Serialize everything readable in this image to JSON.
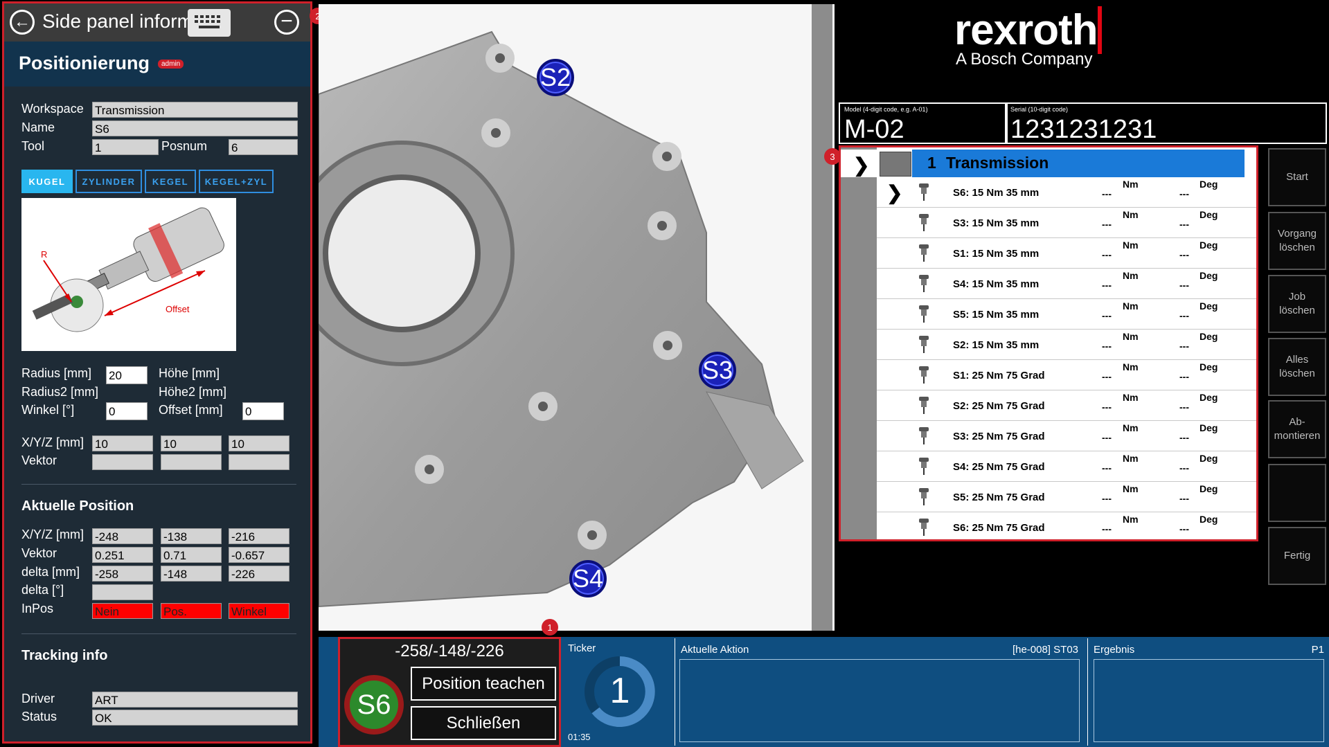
{
  "side_panel": {
    "title": "Side panel inform",
    "back_icon": "arrow-left-icon",
    "keyboard_icon": "keyboard-icon",
    "minimize_icon": "minus-circle-icon",
    "heading": "Positionierung",
    "badge": "admin",
    "workspace": {
      "label": "Workspace",
      "value": "Transmission"
    },
    "name": {
      "label": "Name",
      "value": "S6"
    },
    "tool": {
      "label": "Tool",
      "value": "1"
    },
    "posnum": {
      "label": "Posnum",
      "value": "6"
    },
    "shape_tabs": [
      {
        "label": "KUGEL",
        "active": true
      },
      {
        "label": "ZYLINDER",
        "active": false
      },
      {
        "label": "KEGEL",
        "active": false
      },
      {
        "label": "KEGEL+ZYL",
        "active": false
      }
    ],
    "diagram": {
      "r_label": "R",
      "offset_label": "Offset"
    },
    "radius": {
      "label": "Radius [mm]",
      "value": "20"
    },
    "hoehe": {
      "label": "Höhe [mm]"
    },
    "radius2": {
      "label": "Radius2 [mm]"
    },
    "hoehe2": {
      "label": "Höhe2 [mm]"
    },
    "winkel": {
      "label": "Winkel [°]",
      "value": "0"
    },
    "offset": {
      "label": "Offset [mm]",
      "value": "0"
    },
    "xyz": {
      "label": "X/Y/Z [mm]",
      "values": [
        "10",
        "10",
        "10"
      ]
    },
    "vektor": {
      "label": "Vektor",
      "values": [
        "",
        "",
        ""
      ]
    },
    "current": {
      "title": "Aktuelle Position",
      "xyz": {
        "label": "X/Y/Z [mm]",
        "values": [
          "-248",
          "-138",
          "-216"
        ]
      },
      "vektor": {
        "label": "Vektor",
        "values": [
          "0.251",
          "0.71",
          "-0.657"
        ]
      },
      "delta_mm": {
        "label": "delta [mm]",
        "values": [
          "-258",
          "-148",
          "-226"
        ]
      },
      "delta_deg": {
        "label": "delta [°]",
        "value": ""
      },
      "inpos": {
        "label": "InPos",
        "values": [
          "Nein",
          "Pos.",
          "Winkel"
        ]
      }
    },
    "tracking": {
      "title": "Tracking info",
      "driver": {
        "label": "Driver",
        "value": "ART"
      },
      "status": {
        "label": "Status",
        "value": "OK"
      }
    }
  },
  "callouts": [
    "1",
    "2",
    "3"
  ],
  "image": {
    "markers": [
      "S2",
      "S3",
      "S4"
    ]
  },
  "brand": {
    "name": "rexroth",
    "tagline": "A Bosch Company",
    "accent": "#e30613"
  },
  "model": {
    "caption": "Model (4-digit code, e.g. A-01)",
    "value": "M-02"
  },
  "serial": {
    "caption": "Serial (10-digit code)",
    "value": "1231231231"
  },
  "job_list": {
    "header": {
      "number": "1",
      "title": "Transmission"
    },
    "rows": [
      {
        "name": "S6: 15 Nm 35 mm",
        "v1": "---",
        "u1": "Nm",
        "v2": "---",
        "u2": "Deg",
        "current": true
      },
      {
        "name": "S3: 15 Nm 35 mm",
        "v1": "---",
        "u1": "Nm",
        "v2": "---",
        "u2": "Deg",
        "current": false
      },
      {
        "name": "S1: 15 Nm 35 mm",
        "v1": "---",
        "u1": "Nm",
        "v2": "---",
        "u2": "Deg",
        "current": false
      },
      {
        "name": "S4: 15 Nm 35 mm",
        "v1": "---",
        "u1": "Nm",
        "v2": "---",
        "u2": "Deg",
        "current": false
      },
      {
        "name": "S5: 15 Nm 35 mm",
        "v1": "---",
        "u1": "Nm",
        "v2": "---",
        "u2": "Deg",
        "current": false
      },
      {
        "name": "S2: 15 Nm 35 mm",
        "v1": "---",
        "u1": "Nm",
        "v2": "---",
        "u2": "Deg",
        "current": false
      },
      {
        "name": "S1: 25 Nm 75 Grad",
        "v1": "---",
        "u1": "Nm",
        "v2": "---",
        "u2": "Deg",
        "current": false
      },
      {
        "name": "S2: 25 Nm 75 Grad",
        "v1": "---",
        "u1": "Nm",
        "v2": "---",
        "u2": "Deg",
        "current": false
      },
      {
        "name": "S3: 25 Nm 75 Grad",
        "v1": "---",
        "u1": "Nm",
        "v2": "---",
        "u2": "Deg",
        "current": false
      },
      {
        "name": "S4: 25 Nm 75 Grad",
        "v1": "---",
        "u1": "Nm",
        "v2": "---",
        "u2": "Deg",
        "current": false
      },
      {
        "name": "S5: 25 Nm 75 Grad",
        "v1": "---",
        "u1": "Nm",
        "v2": "---",
        "u2": "Deg",
        "current": false
      },
      {
        "name": "S6: 25 Nm 75 Grad",
        "v1": "---",
        "u1": "Nm",
        "v2": "---",
        "u2": "Deg",
        "current": false
      }
    ]
  },
  "side_buttons": [
    "Start",
    "Vorgang löschen",
    "Job löschen",
    "Alles löschen",
    "Ab-montieren",
    "",
    "Fertig"
  ],
  "bottom": {
    "coords": "-258/-148/-226",
    "current_screw": "S6",
    "teach_button": "Position teachen",
    "close_button": "Schließen",
    "ticker": {
      "label": "Ticker",
      "value": "1",
      "time": "01:35"
    },
    "action": {
      "label": "Aktuelle Aktion",
      "code": "[he-008] ST03"
    },
    "result": {
      "label": "Ergebnis",
      "code": "P1"
    }
  }
}
